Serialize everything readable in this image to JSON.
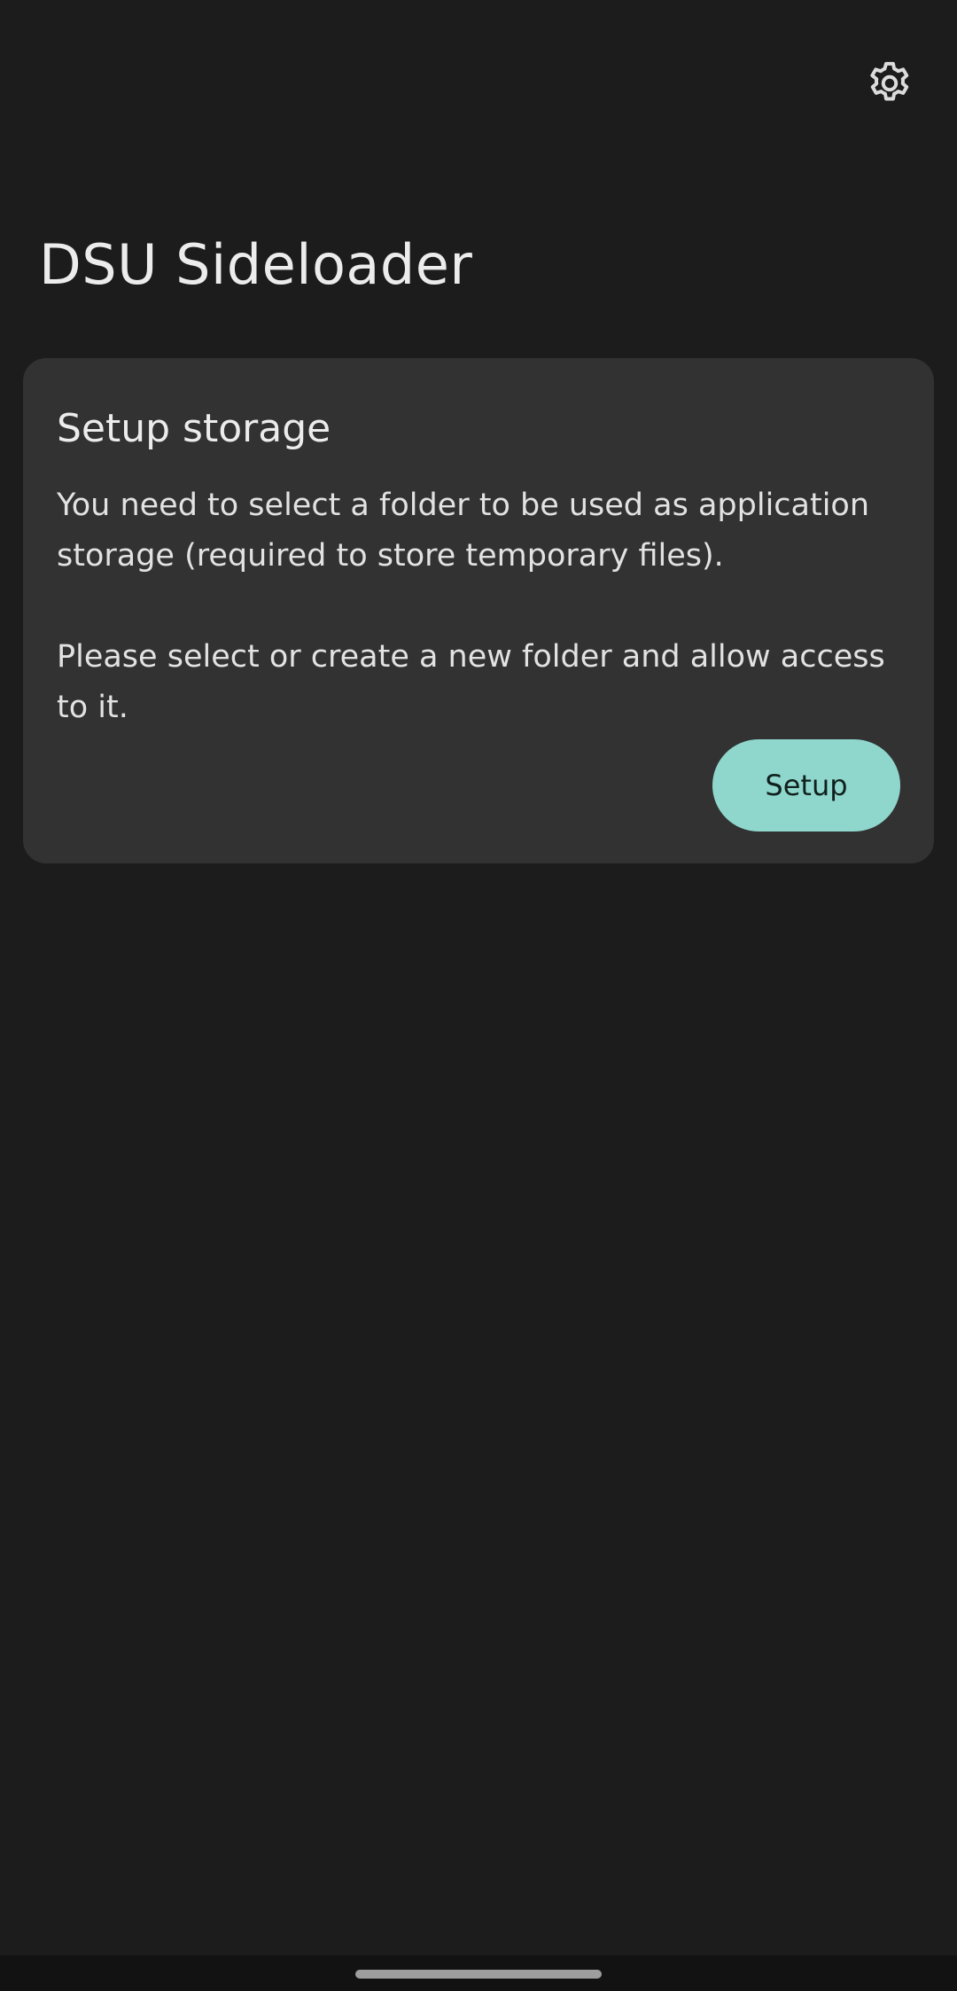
{
  "app": {
    "title": "DSU Sideloader"
  },
  "toolbar": {
    "settings_icon": "gear-icon"
  },
  "storage_card": {
    "title": "Setup storage",
    "paragraph_1": "You need to select a folder to be used as application storage (required to store temporary files).",
    "paragraph_2": "Please select or create a new folder and allow access to it.",
    "button_label": "Setup"
  },
  "colors": {
    "background": "#1c1c1c",
    "card": "#323232",
    "accent": "#8fd7cc",
    "text": "#ececec"
  }
}
